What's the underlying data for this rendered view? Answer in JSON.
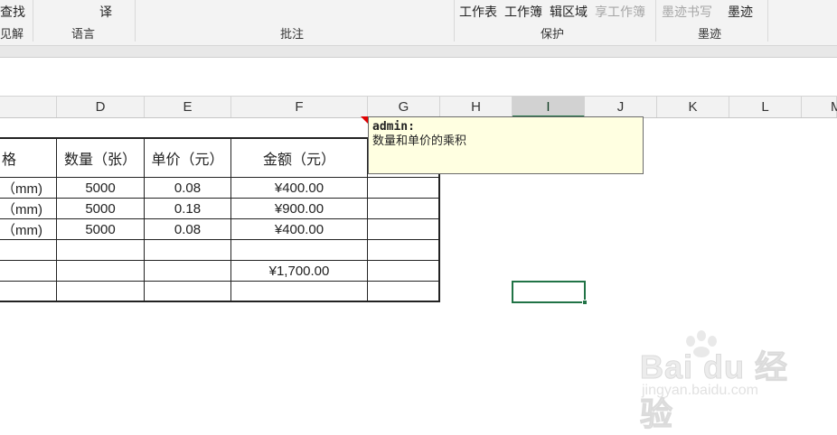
{
  "ribbon": {
    "partial_top": [
      "查找",
      "译"
    ],
    "groups": [
      {
        "label": "见解"
      },
      {
        "label": "语言"
      },
      {
        "label": "批注"
      },
      {
        "label": "保护"
      },
      {
        "label": "墨迹"
      }
    ],
    "protect_buttons": [
      "工作表",
      "工作簿",
      "辑区域",
      "享工作簿"
    ],
    "ink_buttons": [
      "墨迹书写",
      "墨迹"
    ]
  },
  "columns": [
    "D",
    "E",
    "F",
    "G",
    "H",
    "I",
    "J",
    "K",
    "L",
    "M"
  ],
  "selected_column": "I",
  "table": {
    "headers": [
      "格",
      "数量（张）",
      "单价（元）",
      "金额（元）",
      ""
    ],
    "rows": [
      [
        "（mm)",
        "5000",
        "0.08",
        "¥400.00",
        ""
      ],
      [
        "（mm)",
        "5000",
        "0.18",
        "¥900.00",
        ""
      ],
      [
        "（mm)",
        "5000",
        "0.08",
        "¥400.00",
        ""
      ],
      [
        "",
        "",
        "",
        "",
        ""
      ],
      [
        "",
        "",
        "",
        "¥1,700.00",
        ""
      ],
      [
        "",
        "",
        "",
        "",
        ""
      ]
    ]
  },
  "comment": {
    "author": "admin:",
    "text": "数量和单价的乘积"
  },
  "watermark": {
    "brand": "Bai du 经验",
    "url": "jingyan.baidu.com"
  },
  "colors": {
    "accent": "#217346",
    "comment_bg": "#ffffe1",
    "comment_indicator": "#e00000"
  }
}
